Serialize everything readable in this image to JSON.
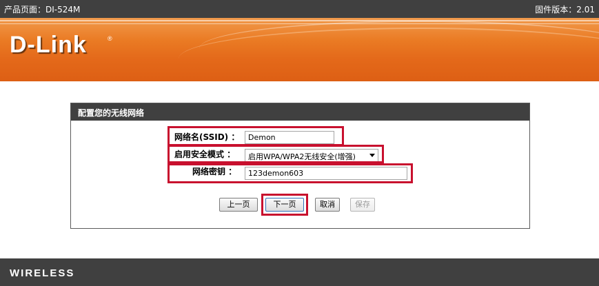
{
  "topbar": {
    "product": "产品页面：DI-524M",
    "firmware": "固件版本：2.01"
  },
  "brand": {
    "logo": "D-Link",
    "registered": "®"
  },
  "wizard": {
    "title": "配置您的无线网络",
    "ssid_label": "网络名(SSID) ：",
    "ssid_value": "Demon",
    "security_label": "启用安全模式 ：",
    "security_selected": "启用WPA/WPA2无线安全(增强)",
    "key_label": "网络密钥 ：",
    "key_value": "123demon603"
  },
  "buttons": {
    "prev": "上一页",
    "next": "下一页",
    "cancel": "取消",
    "save": "保存"
  },
  "footer": {
    "brand_word": "WIRELESS"
  },
  "colors": {
    "brand_orange": "#e4691a",
    "bar_gray": "#404040",
    "highlight_red": "#c8102e"
  }
}
